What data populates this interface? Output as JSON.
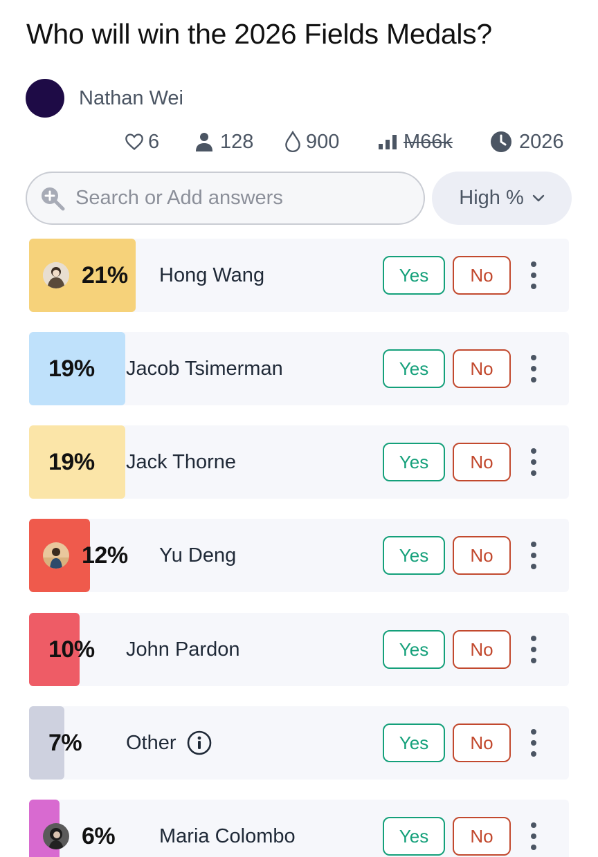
{
  "market": {
    "title": "Who will win the 2026 Fields Medals?"
  },
  "author": {
    "name": "Nathan Wei"
  },
  "stats": {
    "likes": "6",
    "traders": "128",
    "liquidity": "900",
    "volume": "M66k",
    "close": "2026"
  },
  "search": {
    "placeholder": "Search or Add answers"
  },
  "sort": {
    "label": "High %"
  },
  "answers": [
    {
      "name": "Hong Wang",
      "pct": "21%",
      "prob": 0.21,
      "color": "#f6d27a",
      "yes": "Yes",
      "no": "No"
    },
    {
      "name": "Jacob Tsimerman",
      "pct": "19%",
      "prob": 0.19,
      "color": "#bfe1fb",
      "yes": "Yes",
      "no": "No"
    },
    {
      "name": "Jack Thorne",
      "pct": "19%",
      "prob": 0.19,
      "color": "#fbe5a8",
      "yes": "Yes",
      "no": "No"
    },
    {
      "name": "Yu Deng",
      "pct": "12%",
      "prob": 0.12,
      "color": "#ef5a4c",
      "yes": "Yes",
      "no": "No"
    },
    {
      "name": "John Pardon",
      "pct": "10%",
      "prob": 0.1,
      "color": "#ee5c66",
      "yes": "Yes",
      "no": "No"
    },
    {
      "name": "Other",
      "pct": "7%",
      "prob": 0.07,
      "color": "#ced1df",
      "yes": "Yes",
      "no": "No"
    },
    {
      "name": "Maria Colombo",
      "pct": "6%",
      "prob": 0.06,
      "color": "#d86ad0",
      "yes": "Yes",
      "no": "No"
    }
  ],
  "colors": {
    "yes": "#14a07a",
    "no": "#c2492e",
    "avatar": "#1e0b46"
  }
}
